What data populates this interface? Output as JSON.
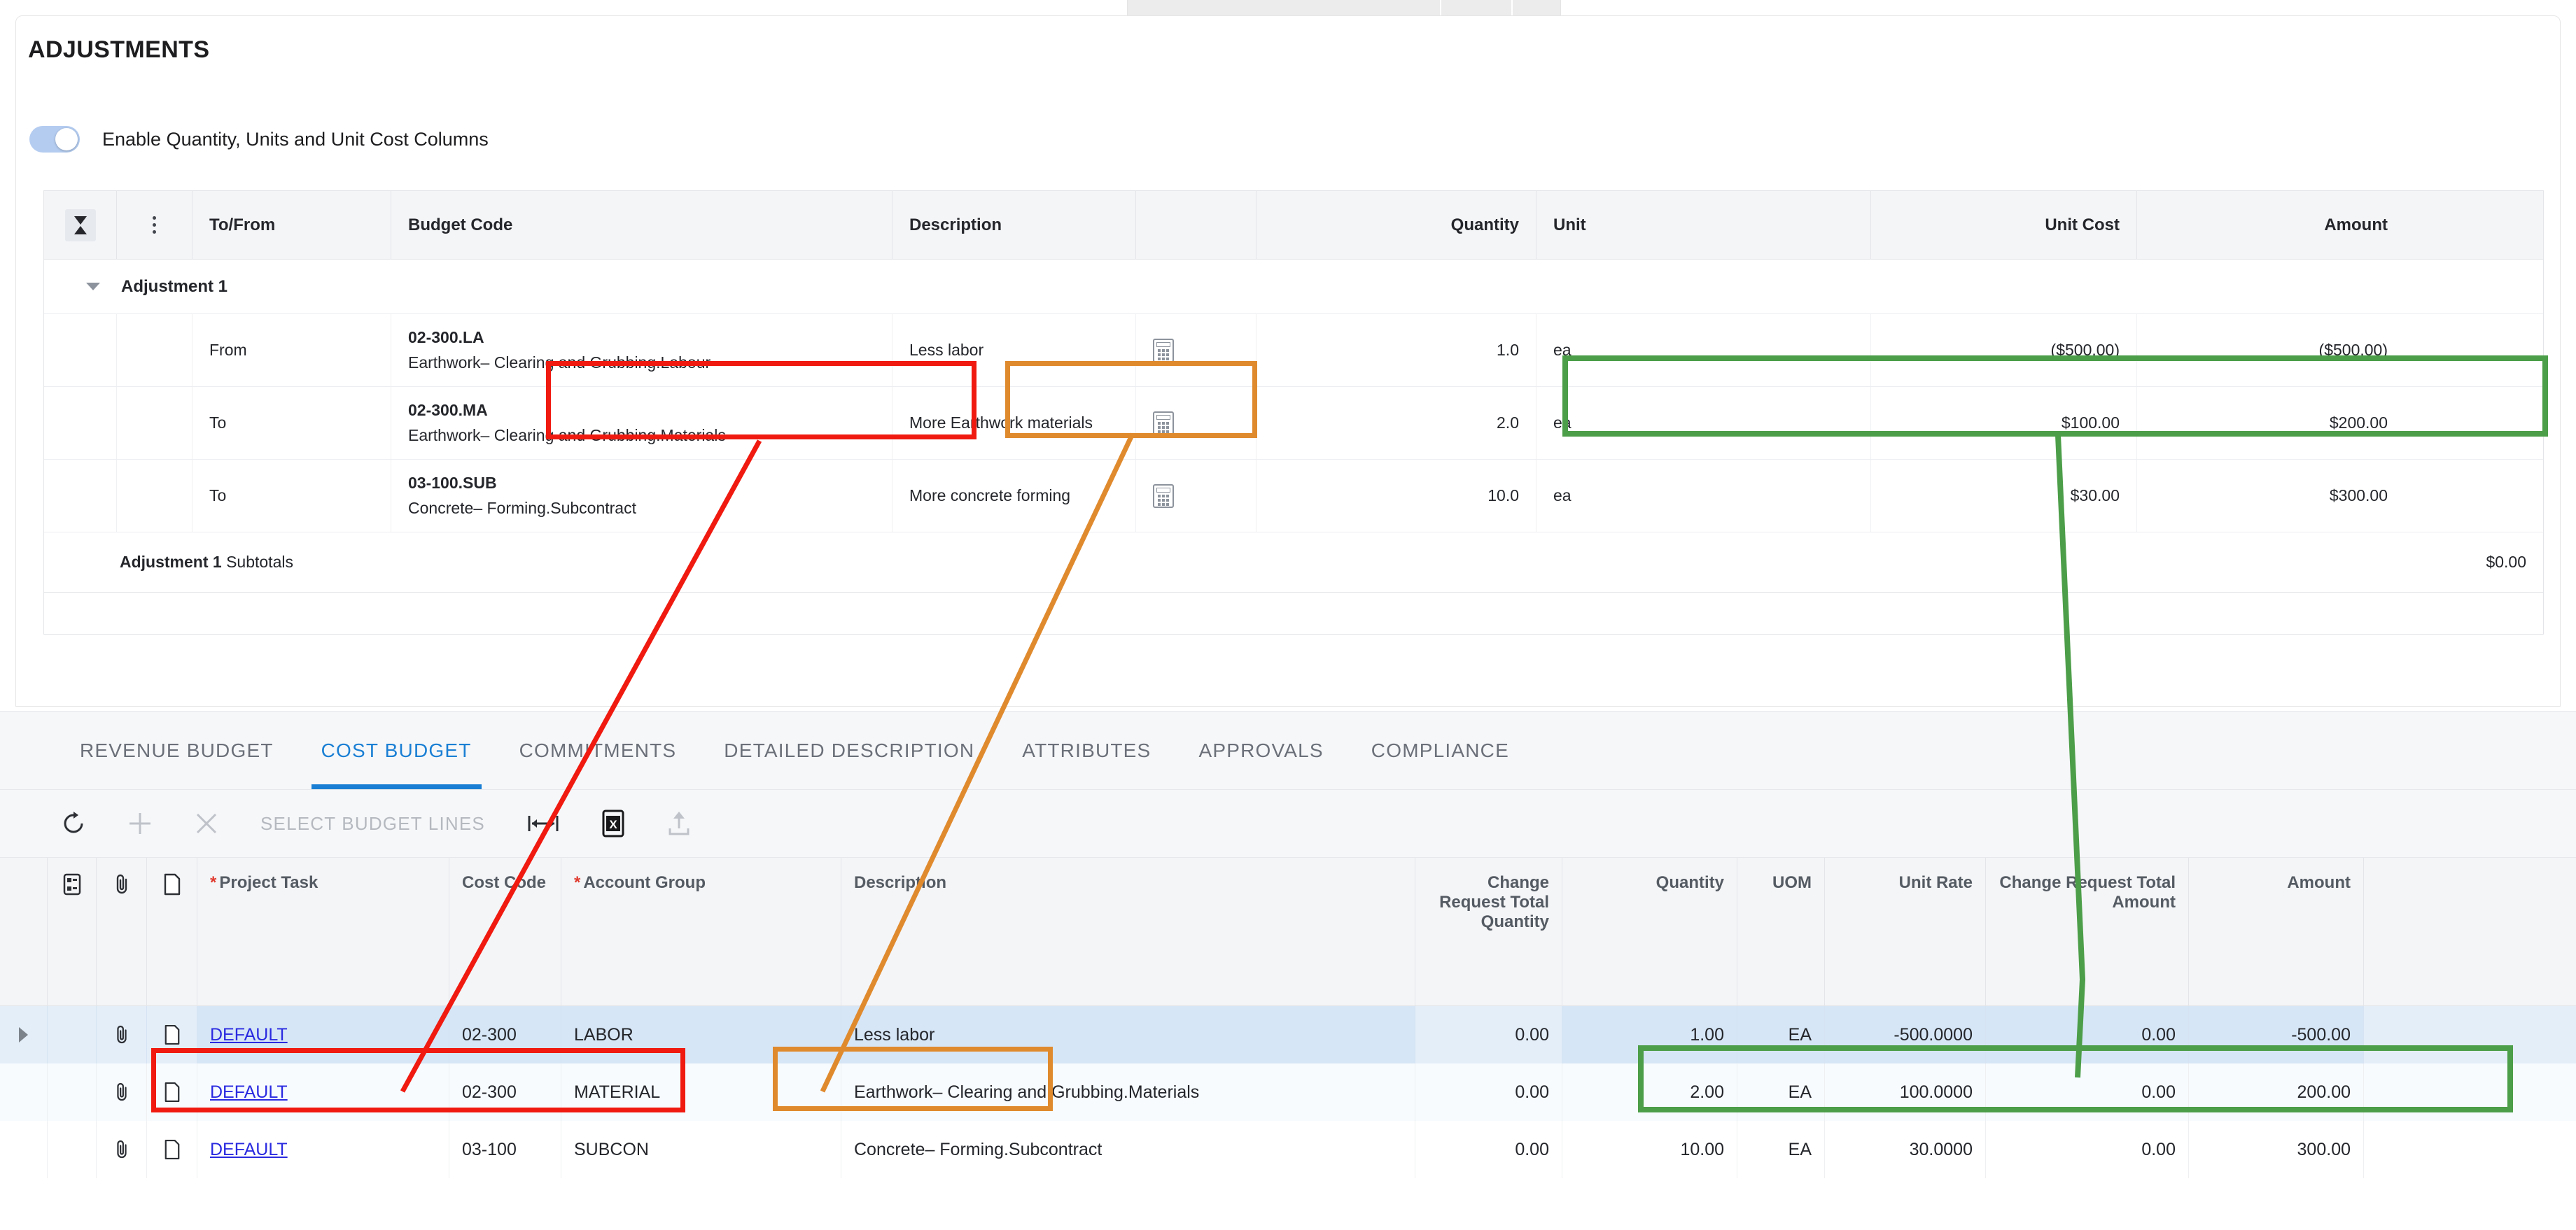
{
  "adjustments": {
    "title": "ADJUSTMENTS",
    "toggle": {
      "label": "Enable Quantity, Units and Unit Cost Columns",
      "state": "on",
      "color": "#b4ccf0"
    },
    "columns": {
      "pin_icon": "hourglass-filter-icon",
      "menu_icon": "kebab-menu-icon",
      "tofrom": "To/From",
      "budget_code": "Budget Code",
      "description": "Description",
      "calc": "",
      "quantity": "Quantity",
      "unit": "Unit",
      "unit_cost": "Unit Cost",
      "amount": "Amount"
    },
    "group_label": "Adjustment 1",
    "rows": [
      {
        "tofrom": "From",
        "code": "02-300.LA",
        "code_desc": "Earthwork– Clearing and Grubbing.Labour",
        "description": "Less labor",
        "calc_icon": "calculator-icon",
        "quantity": "1.0",
        "unit": "ea",
        "unit_cost": "($500.00)",
        "amount": "($500.00)"
      },
      {
        "tofrom": "To",
        "code": "02-300.MA",
        "code_desc": "Earthwork– Clearing and Grubbing.Materials",
        "description": "More Earthwork materials",
        "calc_icon": "calculator-icon",
        "quantity": "2.0",
        "unit": "ea",
        "unit_cost": "$100.00",
        "amount": "$200.00"
      },
      {
        "tofrom": "To",
        "code": "03-100.SUB",
        "code_desc": "Concrete– Forming.Subcontract",
        "description": "More concrete forming",
        "calc_icon": "calculator-icon",
        "quantity": "10.0",
        "unit": "ea",
        "unit_cost": "$30.00",
        "amount": "$300.00"
      }
    ],
    "subtotal": {
      "bold_part": "Adjustment 1",
      "rest": " Subtotals",
      "amount": "$0.00"
    }
  },
  "tabs": {
    "active": "COST BUDGET",
    "items": [
      {
        "label": "REVENUE BUDGET",
        "active": false
      },
      {
        "label": "COST BUDGET",
        "active": true
      },
      {
        "label": "COMMITMENTS",
        "active": false
      },
      {
        "label": "DETAILED DESCRIPTION",
        "active": false
      },
      {
        "label": "ATTRIBUTES",
        "active": false
      },
      {
        "label": "APPROVALS",
        "active": false
      },
      {
        "label": "COMPLIANCE",
        "active": false
      }
    ],
    "accent_color": "#1a7fd4"
  },
  "toolbar": {
    "refresh_icon": "refresh-icon",
    "add_icon": "plus-icon",
    "delete_icon": "close-x-icon",
    "select_budget_lines_label": "SELECT BUDGET LINES",
    "fit_columns_icon": "fit-width-icon",
    "excel_icon": "excel-export-icon",
    "upload_icon": "upload-icon"
  },
  "budget_grid": {
    "columns": {
      "lock_icon": "lock-list-icon",
      "clip_icon": "paperclip-icon",
      "doc_icon": "document-icon",
      "project_task": "Project Task",
      "project_task_required": "*",
      "cost_code": "Cost Code",
      "account_group": "Account Group",
      "account_group_required": "*",
      "description": "Description",
      "change_request_total_quantity": "Change Request Total Quantity",
      "quantity": "Quantity",
      "uom": "UOM",
      "unit_rate": "Unit Rate",
      "change_request_total_amount": "Change Request Total Amount",
      "amount": "Amount"
    },
    "rows": [
      {
        "expanded_icon": "chevron-right-icon",
        "clip_icon": "paperclip-icon",
        "doc_icon": "document-icon",
        "project_task": "DEFAULT",
        "cost_code": "02-300",
        "account_group": "LABOR",
        "description": "Less labor",
        "change_request_total_quantity": "0.00",
        "quantity": "1.00",
        "uom": "EA",
        "unit_rate": "-500.0000",
        "change_request_total_amount": "0.00",
        "amount": "-500.00",
        "selected": true
      },
      {
        "expanded_icon": "",
        "clip_icon": "paperclip-icon",
        "doc_icon": "document-icon",
        "project_task": "DEFAULT",
        "cost_code": "02-300",
        "account_group": "MATERIAL",
        "description": "Earthwork– Clearing and Grubbing.Materials",
        "change_request_total_quantity": "0.00",
        "quantity": "2.00",
        "uom": "EA",
        "unit_rate": "100.0000",
        "change_request_total_amount": "0.00",
        "amount": "200.00",
        "selected": false
      },
      {
        "expanded_icon": "",
        "clip_icon": "paperclip-icon",
        "doc_icon": "document-icon",
        "project_task": "DEFAULT",
        "cost_code": "03-100",
        "account_group": "SUBCON",
        "description": "Concrete– Forming.Subcontract",
        "change_request_total_quantity": "0.00",
        "quantity": "10.00",
        "uom": "EA",
        "unit_rate": "30.0000",
        "change_request_total_amount": "0.00",
        "amount": "300.00",
        "selected": false
      }
    ]
  },
  "annotations": {
    "red": {
      "color": "#f01a10",
      "label": "budget-code-to-task-link"
    },
    "orange": {
      "color": "#e08a2e",
      "label": "description-link"
    },
    "green": {
      "color": "#4c9e48",
      "label": "quantity-amount-link"
    }
  }
}
